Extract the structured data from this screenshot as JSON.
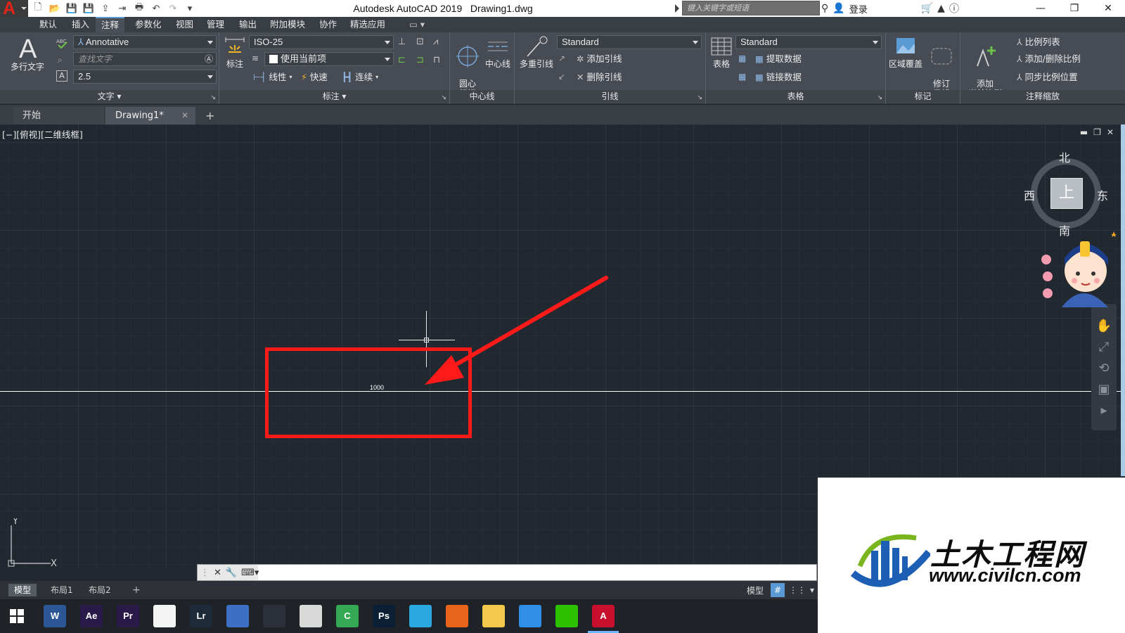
{
  "titlebar": {
    "app_title": "Autodesk AutoCAD 2019",
    "document": "Drawing1.dwg",
    "search_placeholder": "键入关键字或短语",
    "login": "登录",
    "logo_letter": "A"
  },
  "menu_tabs": [
    "默认",
    "插入",
    "注释",
    "参数化",
    "视图",
    "管理",
    "输出",
    "附加模块",
    "协作",
    "精选应用"
  ],
  "active_menu_tab": "注释",
  "ribbon": {
    "text_panel": {
      "label": "文字",
      "mtext_label": "多行文字",
      "style_value": "Annotative",
      "find_placeholder": "查找文字",
      "height_value": "2.5"
    },
    "dim_panel": {
      "label": "标注",
      "dim_button": "标注",
      "style_value": "ISO-25",
      "layer_value": "使用当前项",
      "linear": "线性",
      "quick": "快速",
      "continue": "连续"
    },
    "centerline_panel": {
      "label": "中心线",
      "center_mark": "圆心\n标记",
      "centerline": "中心线"
    },
    "leader_panel": {
      "label": "引线",
      "mleader": "多重引线",
      "style_value": "Standard",
      "add_leader": "添加引线",
      "remove_leader": "删除引线"
    },
    "table_panel": {
      "label": "表格",
      "table": "表格",
      "style_value": "Standard",
      "extract": "提取数据",
      "link": "链接数据"
    },
    "markup_panel": {
      "label": "标记",
      "wipeout": "区域覆盖",
      "revcloud": "修订\n云线"
    },
    "scale_panel": {
      "label": "注释缩放",
      "add_current": "添加\n当前比例",
      "scale_list": "比例列表",
      "add_remove": "添加/删除比例",
      "sync": "同步比例位置"
    }
  },
  "doc_tabs": {
    "start": "开始",
    "drawing": "Drawing1*"
  },
  "viewport": {
    "label": "[−][俯视][二维线框]",
    "dimension_text": "1000"
  },
  "viewcube": {
    "north": "北",
    "south": "南",
    "west": "西",
    "east": "东",
    "face": "上"
  },
  "ucs": {
    "x": "X",
    "y": "Y"
  },
  "layout_tabs": [
    "模型",
    "布局1",
    "布局2"
  ],
  "status": {
    "model": "模型"
  },
  "taskbar_apps": [
    {
      "name": "word",
      "label": "W",
      "color": "#2b5797"
    },
    {
      "name": "after-effects",
      "label": "Ae",
      "color": "#2a1a4a"
    },
    {
      "name": "premiere",
      "label": "Pr",
      "color": "#2a1a4a"
    },
    {
      "name": "notepad",
      "label": "",
      "color": "#f4f4f4"
    },
    {
      "name": "lightroom",
      "label": "Lr",
      "color": "#1c2a3a"
    },
    {
      "name": "app-blue",
      "label": "",
      "color": "#3d6fc4"
    },
    {
      "name": "app-city",
      "label": "",
      "color": "#2a2f3a"
    },
    {
      "name": "app-cat",
      "label": "",
      "color": "#d9d9d9"
    },
    {
      "name": "camtasia",
      "label": "C",
      "color": "#34a853"
    },
    {
      "name": "photoshop",
      "label": "Ps",
      "color": "#0b2035"
    },
    {
      "name": "app-monitor",
      "label": "",
      "color": "#29a9e0"
    },
    {
      "name": "firefox",
      "label": "",
      "color": "#e8641b"
    },
    {
      "name": "explorer",
      "label": "",
      "color": "#f2c94c"
    },
    {
      "name": "app-swirl",
      "label": "",
      "color": "#2f8ee5"
    },
    {
      "name": "wechat",
      "label": "",
      "color": "#2dc100"
    },
    {
      "name": "autocad",
      "label": "A",
      "color": "#c8102e"
    }
  ],
  "watermark": {
    "title": "土木工程网",
    "url": "www.civilcn.com"
  },
  "colors": {
    "canvas_bg": "#212830",
    "highlight": "#ff1a1a",
    "accent": "#5b9bd5"
  }
}
